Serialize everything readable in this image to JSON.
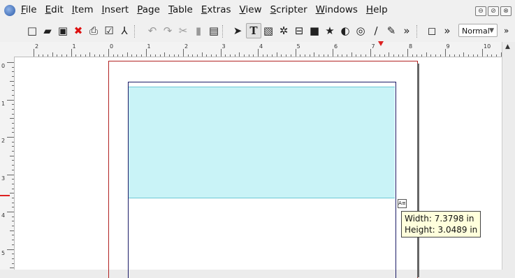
{
  "menu": [
    "File",
    "Edit",
    "Item",
    "Insert",
    "Page",
    "Table",
    "Extras",
    "View",
    "Scripter",
    "Windows",
    "Help"
  ],
  "window_buttons": [
    "⊖",
    "⊘",
    "⊗"
  ],
  "toolbar": {
    "icons": [
      {
        "name": "new-document-icon",
        "glyph": "□"
      },
      {
        "name": "open-icon",
        "glyph": "▰"
      },
      {
        "name": "save-icon",
        "glyph": "▣"
      },
      {
        "name": "close-document-icon",
        "glyph": "✖",
        "color": "#d11"
      },
      {
        "name": "print-icon",
        "glyph": "⎙"
      },
      {
        "name": "preflight-check-icon",
        "glyph": "☑"
      },
      {
        "name": "export-pdf-icon",
        "glyph": "⅄"
      },
      {
        "name": "undo-icon",
        "glyph": "↶",
        "color": "#999"
      },
      {
        "name": "redo-icon",
        "glyph": "↷",
        "color": "#999"
      },
      {
        "name": "cut-icon",
        "glyph": "✂",
        "color": "#999"
      },
      {
        "name": "copy-icon",
        "glyph": "▮",
        "color": "#999"
      },
      {
        "name": "paste-icon",
        "glyph": "▤"
      },
      {
        "name": "select-tool-icon",
        "glyph": "➤"
      },
      {
        "name": "text-frame-tool-icon",
        "glyph": "T",
        "selected": true
      },
      {
        "name": "image-frame-tool-icon",
        "glyph": "▧"
      },
      {
        "name": "render-frame-tool-icon",
        "glyph": "✲"
      },
      {
        "name": "table-tool-icon",
        "glyph": "⊟"
      },
      {
        "name": "shape-tool-icon",
        "glyph": "■"
      },
      {
        "name": "polygon-tool-icon",
        "glyph": "★"
      },
      {
        "name": "arc-tool-icon",
        "glyph": "◐"
      },
      {
        "name": "spiral-tool-icon",
        "glyph": "◎"
      },
      {
        "name": "line-tool-icon",
        "glyph": "∕"
      },
      {
        "name": "bezier-tool-icon",
        "glyph": "✎"
      },
      {
        "name": "more-tools-icon",
        "glyph": "»"
      },
      {
        "name": "preview-mode-icon",
        "glyph": "◻"
      },
      {
        "name": "more-view-icon",
        "glyph": "»"
      }
    ],
    "zoom_mode": "Normal",
    "overflow": "»"
  },
  "hruler_numbers": [
    "2",
    "1",
    "0",
    "1",
    "2",
    "3",
    "4",
    "5",
    "6",
    "7",
    "8",
    "9",
    "10"
  ],
  "vruler_numbers": [
    "0",
    "1",
    "2",
    "3",
    "4",
    "5"
  ],
  "tooltip": {
    "width": "Width: 7.3798 in",
    "height": "Height: 3.0489 in"
  },
  "frame_handle_label": "A≡"
}
